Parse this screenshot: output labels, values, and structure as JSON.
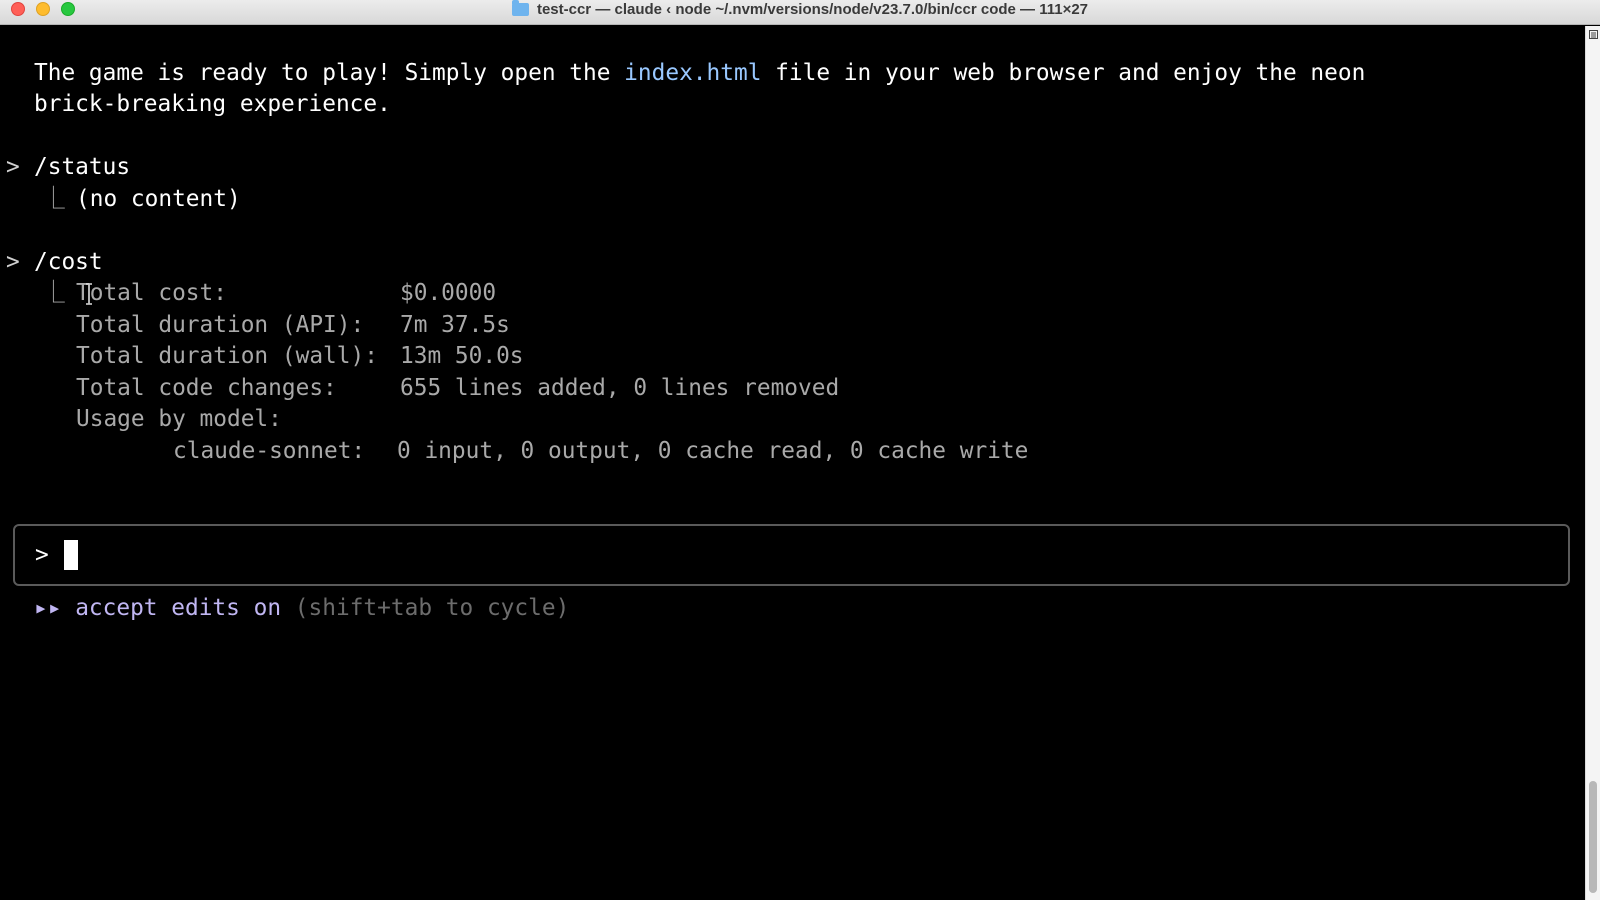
{
  "window": {
    "title": "test-ccr — claude ‹ node ~/.nvm/versions/node/v23.7.0/bin/ccr code — 111×27",
    "icons": [
      "close-icon",
      "minimize-icon",
      "maximize-icon",
      "folder-icon"
    ]
  },
  "terminal": {
    "intro": {
      "line1_before": "The game is ready to play! Simply open the ",
      "line1_link": "index.html",
      "line1_after": " file in your web browser and enjoy the neon",
      "line2": "brick-breaking experience."
    },
    "commands": [
      {
        "prompt": ">",
        "command": "/status",
        "tree_glyph": "⎿",
        "output": "(no content)"
      },
      {
        "prompt": ">",
        "command": "/cost",
        "tree_glyph": "⎿",
        "rows": [
          {
            "label": "Total cost:",
            "value": "$0.0000"
          },
          {
            "label": "Total duration (API):",
            "value": "7m 37.5s"
          },
          {
            "label": "Total duration (wall):",
            "value": "13m 50.0s"
          },
          {
            "label": "Total code changes:",
            "value": "655 lines added, 0 lines removed"
          }
        ],
        "usage_heading": "Usage by model:",
        "usage_rows": [
          {
            "model": "claude-sonnet:",
            "value": "0 input, 0 output, 0 cache read, 0 cache write"
          }
        ]
      }
    ],
    "input": {
      "prompt": ">",
      "value": ""
    },
    "mode": {
      "glyph": "▸▸",
      "label": "accept edits on",
      "hint": "(shift+tab to cycle)"
    }
  },
  "colors": {
    "background": "#000000",
    "link": "#99c8ff",
    "muted": "#a9a9a9",
    "mode": "#c0b6f2",
    "hint": "#6c6c6c"
  }
}
